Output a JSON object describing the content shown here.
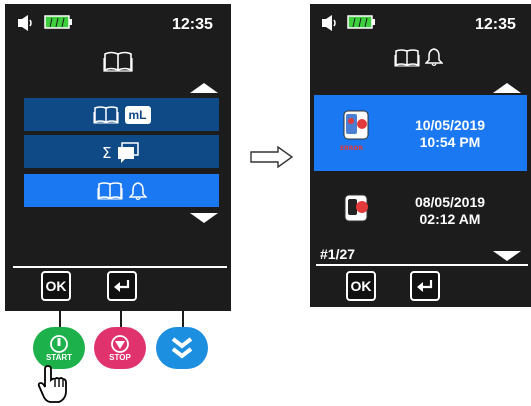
{
  "colors": {
    "screen_bg": "#1c1c1c",
    "menu_bar": "#0f4a86",
    "menu_selected": "#1a78f2",
    "battery": "#3ecf3e",
    "start": "#1db14b",
    "stop": "#e0336e",
    "scroll": "#1d8fe0"
  },
  "left_screen": {
    "time": "12:35",
    "header_icon": "book-icon",
    "menu": [
      {
        "icons": [
          "book-icon"
        ],
        "badge": "mL",
        "selected": false
      },
      {
        "icons": [
          "sigma-icon",
          "stack-icon"
        ],
        "badge": "",
        "selected": false
      },
      {
        "icons": [
          "book-icon",
          "bell-icon"
        ],
        "badge": "",
        "selected": true
      }
    ],
    "ok_label": "OK",
    "enter_icon": "enter-icon"
  },
  "transition_icon": "arrow-right-icon",
  "right_screen": {
    "time": "12:35",
    "header_icons": [
      "book-icon",
      "bell-icon"
    ],
    "events": [
      {
        "date": "10/05/2019",
        "time": "10:54 PM",
        "icon": "alarm-device-icon",
        "selected": true
      },
      {
        "date": "08/05/2019",
        "time": "02:12 AM",
        "icon": "device-icon",
        "selected": false
      }
    ],
    "page_counter": "#1/27",
    "ok_label": "OK",
    "enter_icon": "enter-icon"
  },
  "hardware_buttons": {
    "start_label": "START",
    "stop_label": "STOP",
    "scroll_icon": "double-chevron-down-icon"
  }
}
